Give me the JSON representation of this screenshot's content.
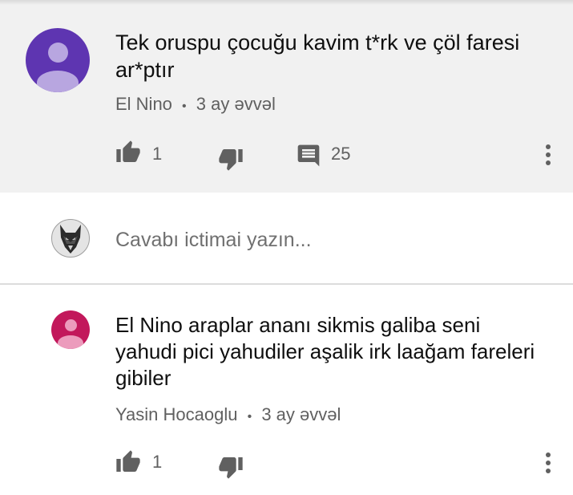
{
  "comment": {
    "text": "Tek oruspu çocuğu kavim t*rk ve çöl faresi ar*ptır",
    "author": "El Nino",
    "separator": "•",
    "time": "3 ay əvvəl",
    "likes": "1",
    "replies": "25",
    "avatar_color": "#5e35b1"
  },
  "reply_input": {
    "placeholder": "Cavabı ictimai yazın..."
  },
  "reply": {
    "text": "El Nino  araplar ananı sikmis galiba seni yahudi pici yahudiler aşalik irk laağam fareleri gibiler",
    "author": "Yasin Hocaoglu",
    "separator": "•",
    "time": "3 ay əvvəl",
    "likes": "1",
    "avatar_color": "#c2185b"
  },
  "icons": {
    "like": "thumb-up-icon",
    "dislike": "thumb-down-icon",
    "reply": "comment-icon",
    "more": "more-vert-icon"
  }
}
